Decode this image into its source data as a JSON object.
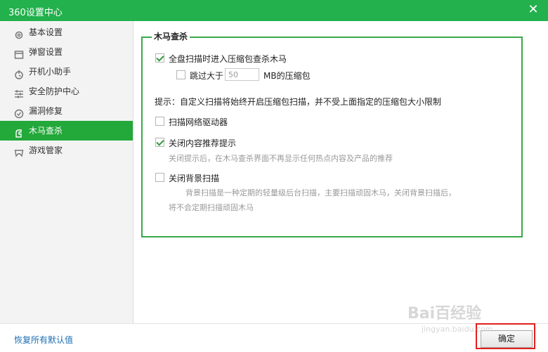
{
  "window": {
    "title": "360设置中心",
    "close_symbol": "✕"
  },
  "sidebar": {
    "items": [
      {
        "label": "基本设置",
        "icon": "gear-icon",
        "active": false
      },
      {
        "label": "弹窗设置",
        "icon": "window-icon",
        "active": false
      },
      {
        "label": "开机小助手",
        "icon": "power-clock-icon",
        "active": false
      },
      {
        "label": "安全防护中心",
        "icon": "sliders-icon",
        "active": false
      },
      {
        "label": "漏洞修复",
        "icon": "patch-icon",
        "active": false
      },
      {
        "label": "木马查杀",
        "icon": "trojan-icon",
        "active": true
      },
      {
        "label": "游戏管家",
        "icon": "gamepad-icon",
        "active": false
      }
    ]
  },
  "main": {
    "group_title": "木马查杀",
    "options": {
      "scan_archives": {
        "label": "全盘扫描时进入压缩包查杀木马",
        "checked": true
      },
      "skip_large": {
        "prefix": "跳过大于",
        "value": "50",
        "suffix": "MB的压缩包",
        "checked": false
      },
      "tip": "提示：自定义扫描将始终开启压缩包扫描，并不受上面指定的压缩包大小限制",
      "scan_drivers": {
        "label": "扫描网络驱动器",
        "checked": false
      },
      "close_recommend": {
        "label": "关闭内容推荐提示",
        "checked": true,
        "desc": "关闭提示后，在木马查杀界面不再显示任何热点内容及产品的推荐"
      },
      "close_bg_scan": {
        "label": "关闭背景扫描",
        "checked": false,
        "desc_line1": "背景扫描是一种定期的轻量级后台扫描，主要扫描顽固木马，关闭背景扫描后，",
        "desc_line2": "将不会定期扫描顽固木马"
      }
    }
  },
  "footer": {
    "reset_label": "恢复所有默认值",
    "ok_label": "确定"
  },
  "watermark": {
    "brand": "Bai百经验",
    "url": "jingyan.baidu.com"
  },
  "colors": {
    "titlebar": "#22b14c",
    "active_nav": "#23a83a",
    "group_border": "#3aa84a",
    "highlight": "#e0201c",
    "link": "#1a6db3"
  }
}
